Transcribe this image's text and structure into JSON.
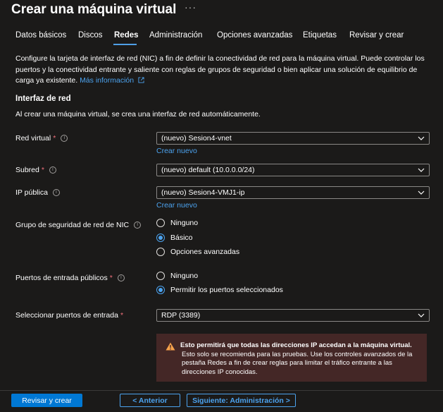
{
  "header": {
    "title": "Crear una máquina virtual",
    "more": "···"
  },
  "tabs": [
    {
      "label": "Datos básicos"
    },
    {
      "label": "Discos"
    },
    {
      "label": "Redes"
    },
    {
      "label": "Administración"
    },
    {
      "label": "Opciones avanzadas"
    },
    {
      "label": "Etiquetas"
    },
    {
      "label": "Revisar y crear"
    }
  ],
  "active_tab": "Redes",
  "intro": {
    "text": "Configure la tarjeta de interfaz de red (NIC) a fin de definir la conectividad de red para la máquina virtual. Puede controlar los puertos y la conectividad entrante y saliente con reglas de grupos de seguridad o bien aplicar una solución de equilibrio de carga ya existente.",
    "link": "Más información"
  },
  "section": {
    "title": "Interfaz de red",
    "subtitle": "Al crear una máquina virtual, se crea una interfaz de red automáticamente."
  },
  "fields": {
    "vnet": {
      "label": "Red virtual",
      "required": "*",
      "value": "(nuevo) Sesion4-vnet",
      "create_new": "Crear nuevo"
    },
    "subnet": {
      "label": "Subred",
      "required": "*",
      "value": "(nuevo) default (10.0.0.0/24)"
    },
    "public_ip": {
      "label": "IP pública",
      "value": "(nuevo) Sesion4-VMJ1-ip",
      "create_new": "Crear nuevo"
    },
    "nsg": {
      "label": "Grupo de seguridad de red de NIC",
      "options": [
        "Ninguno",
        "Básico",
        "Opciones avanzadas"
      ],
      "selected": "Básico"
    },
    "inbound_ports": {
      "label": "Puertos de entrada públicos",
      "required": "*",
      "options": [
        "Ninguno",
        "Permitir los puertos seleccionados"
      ],
      "selected": "Permitir los puertos seleccionados"
    },
    "select_ports": {
      "label": "Seleccionar puertos de entrada",
      "required": "*",
      "value": "RDP (3389)"
    }
  },
  "warning": {
    "title": "Esto permitirá que todas las direcciones IP accedan a la máquina virtual.",
    "body": "Esto solo se recomienda para las pruebas.  Use los controles avanzados de la pestaña Redes a fin de crear reglas para limitar el tráfico entrante a las direcciones IP conocidas."
  },
  "footer": {
    "review": "Revisar y crear",
    "prev": "< Anterior",
    "next": "Siguiente: Administración >"
  },
  "colors": {
    "accent": "#4ca3ef",
    "primary": "#0078d4",
    "warning_bg": "#442726",
    "warning_icon": "#f7a24b",
    "required": "#f1707b"
  }
}
